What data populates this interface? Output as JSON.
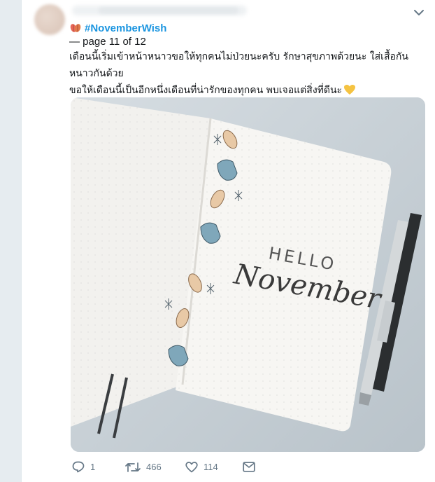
{
  "tweet": {
    "hashtag": "#NovemberWish",
    "page_label": "— page 11 of 12",
    "line1": "เดือนนี้เริ่มเข้าหน้าหนาวขอให้ทุกคนไม่ป่วยนะครับ รักษาสุขภาพด้วยนะ ใส่เสื้อกันหนาวกันด้วย",
    "line2": "ขอให้เดือนนี้เป็นอีกหนึ่งเดือนที่น่ารักของทุกคน พบเจอแต่สิ่งที่ดีนะ",
    "image": {
      "lettering_top": "HELLO",
      "lettering_script": "November"
    }
  },
  "actions": {
    "reply_count": "1",
    "retweet_count": "466",
    "like_count": "114"
  },
  "icons": {
    "hashtag_emoji": "fallen-leaf-icon",
    "heart_emoji": "yellow-heart-icon",
    "reply": "reply-icon",
    "retweet": "retweet-icon",
    "like": "like-icon",
    "dm": "message-icon",
    "menu": "chevron-down-icon"
  },
  "colors": {
    "link": "#1b95e0",
    "text": "#14171a",
    "muted": "#657786",
    "heart_emoji": "#f5c342"
  }
}
